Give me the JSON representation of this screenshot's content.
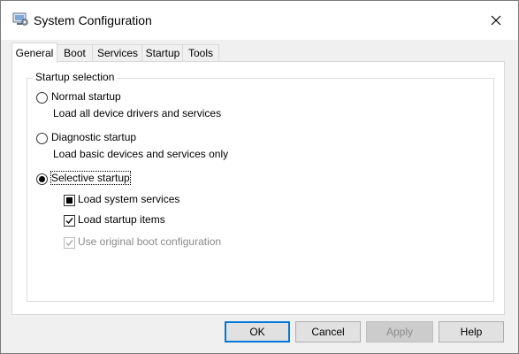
{
  "window": {
    "title": "System Configuration"
  },
  "tabs": [
    "General",
    "Boot",
    "Services",
    "Startup",
    "Tools"
  ],
  "group": {
    "legend": "Startup selection"
  },
  "options": {
    "normal": {
      "label": "Normal startup",
      "desc": "Load all device drivers and services",
      "checked": false
    },
    "diagnostic": {
      "label": "Diagnostic startup",
      "desc": "Load basic devices and services only",
      "checked": false
    },
    "selective": {
      "label": "Selective startup",
      "checked": true
    },
    "load_system_services": {
      "label": "Load system services",
      "state": "indeterminate"
    },
    "load_startup_items": {
      "label": "Load startup items",
      "state": "checked"
    },
    "use_original_boot": {
      "label": "Use original boot configuration",
      "state": "checked-disabled"
    }
  },
  "buttons": {
    "ok": "OK",
    "cancel": "Cancel",
    "apply": "Apply",
    "help": "Help"
  },
  "icons": {
    "app": "msconfig-icon",
    "close": "close-icon"
  }
}
